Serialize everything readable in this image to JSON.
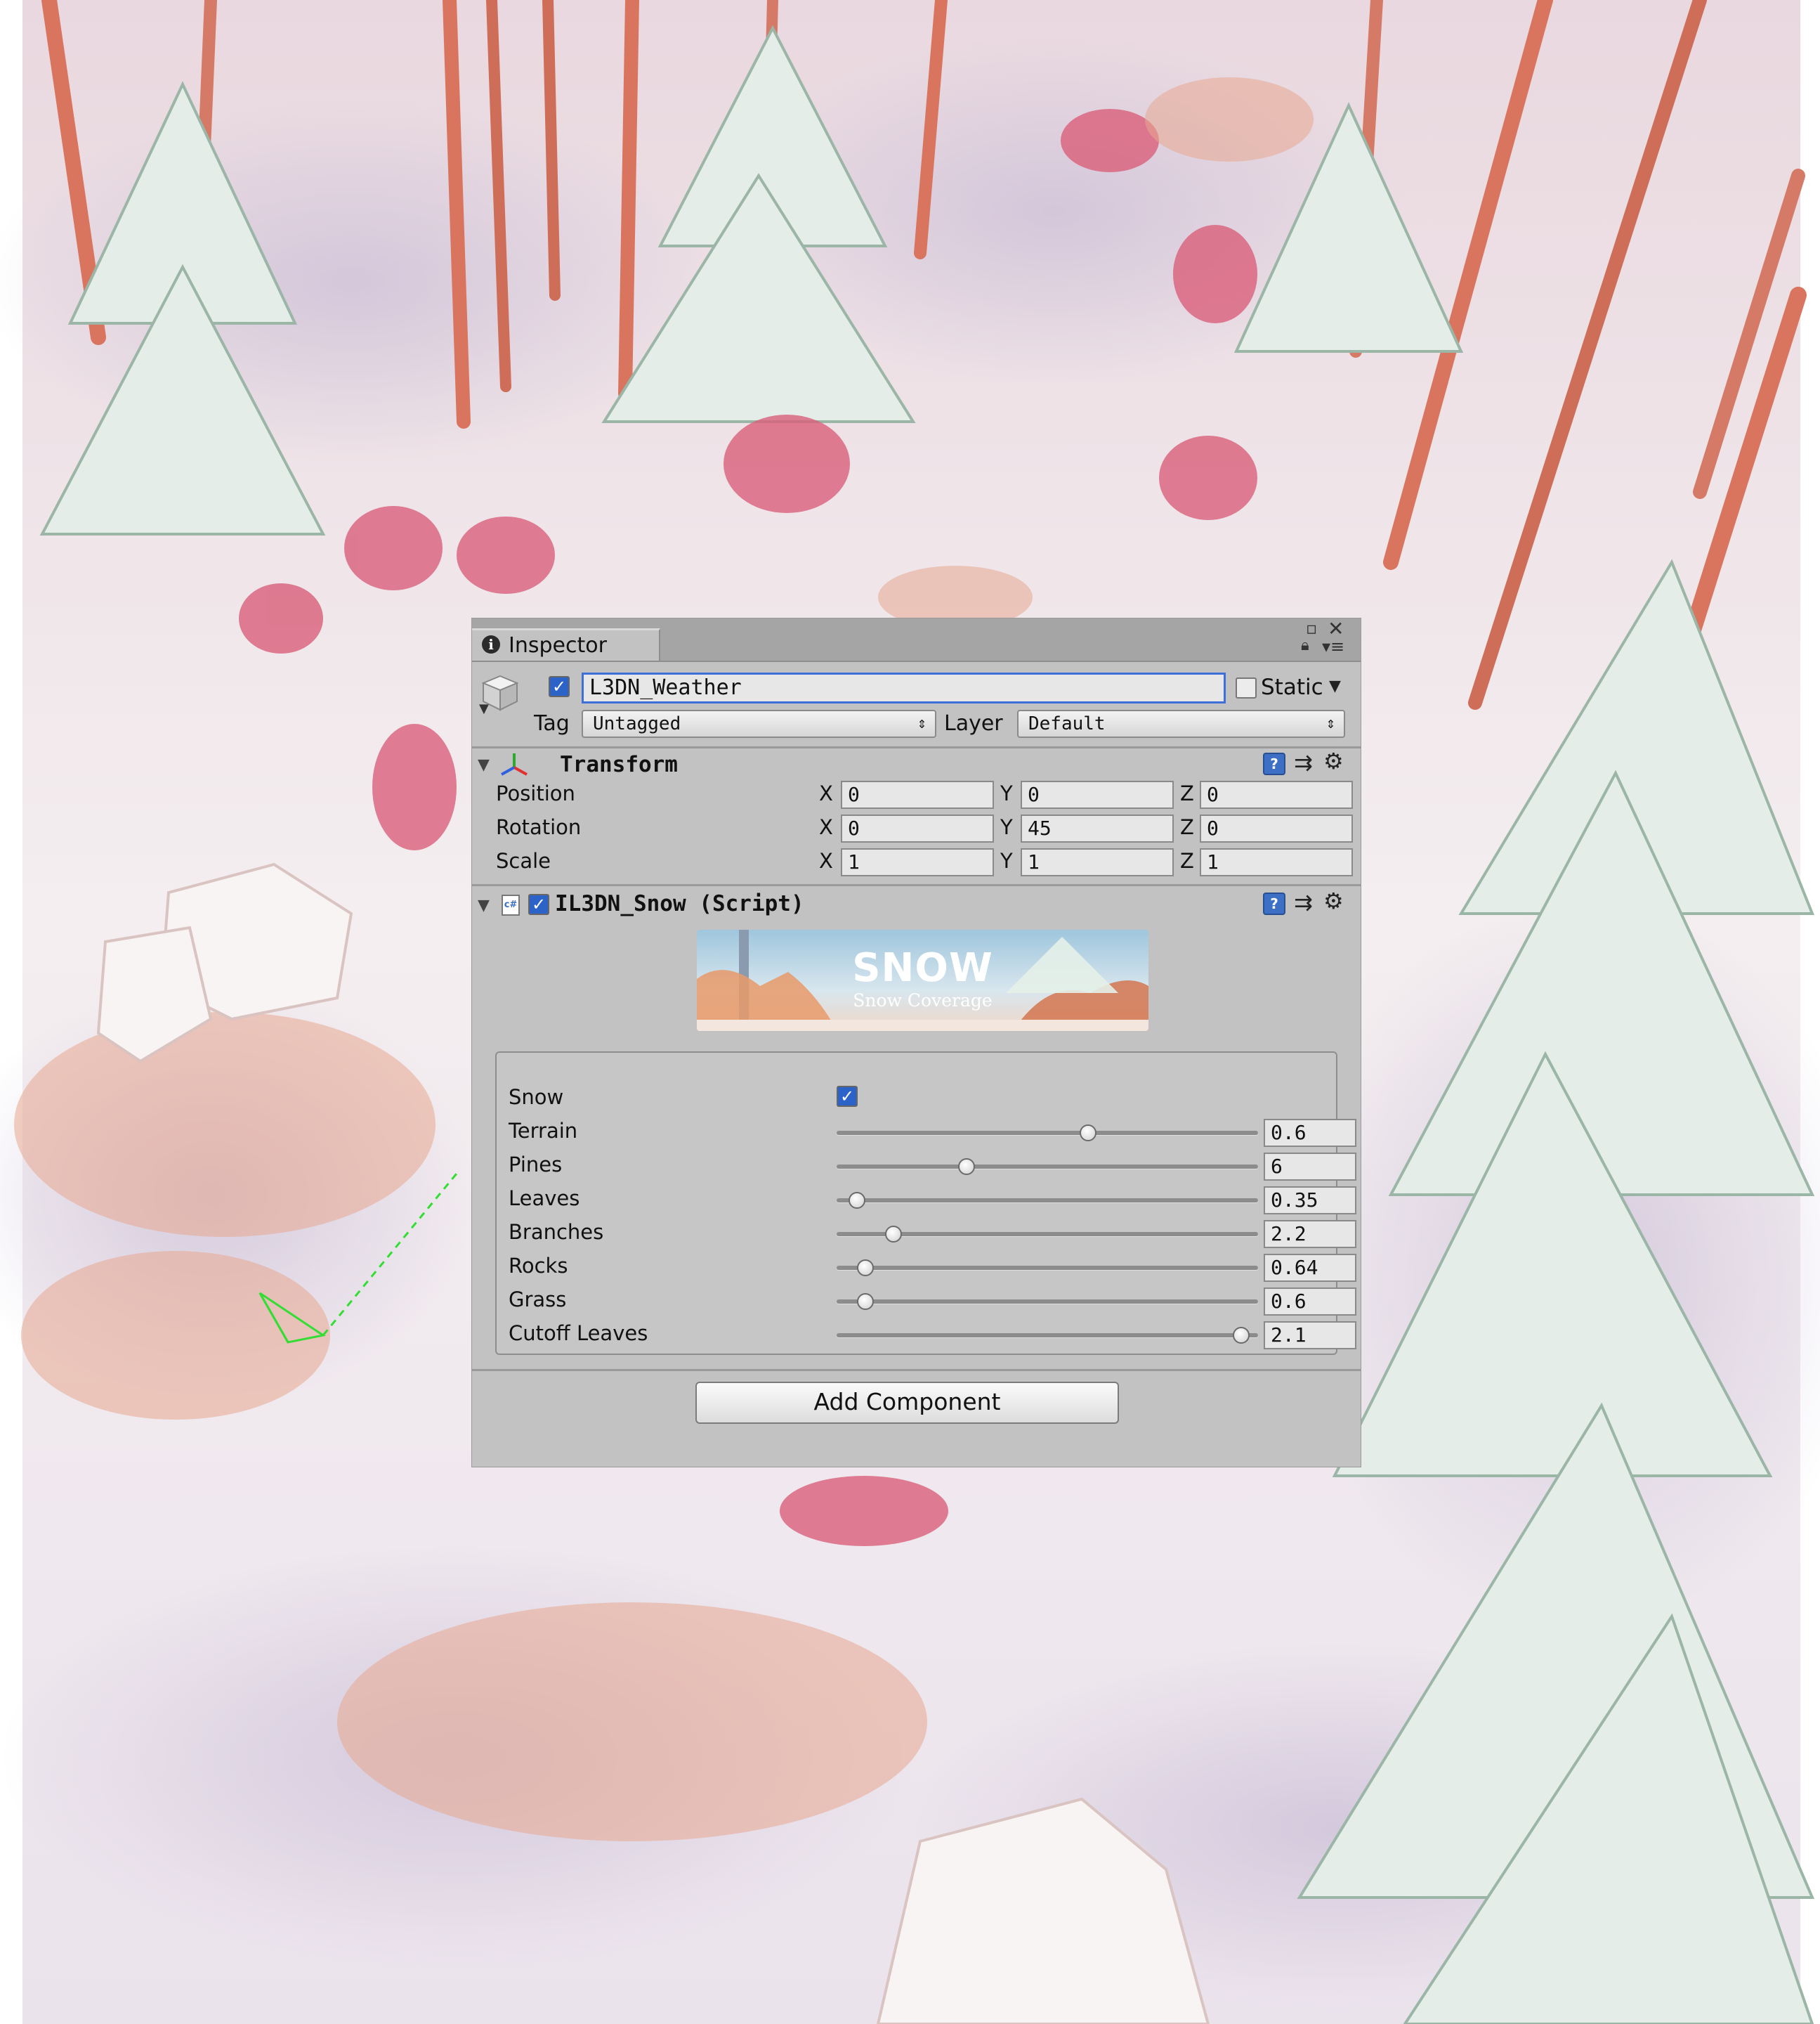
{
  "window": {
    "tab_title": "Inspector"
  },
  "gameobject": {
    "active": true,
    "name": "L3DN_Weather",
    "static_label": "Static",
    "static_checked": false,
    "tag_label": "Tag",
    "tag_value": "Untagged",
    "layer_label": "Layer",
    "layer_value": "Default"
  },
  "transform": {
    "title": "Transform",
    "rows": [
      {
        "label": "Position",
        "x": "0",
        "y": "0",
        "z": "0"
      },
      {
        "label": "Rotation",
        "x": "0",
        "y": "45",
        "z": "0"
      },
      {
        "label": "Scale",
        "x": "1",
        "y": "1",
        "z": "1"
      }
    ],
    "axis_labels": {
      "x": "X",
      "y": "Y",
      "z": "Z"
    }
  },
  "script_component": {
    "enabled": true,
    "title": "IL3DN_Snow (Script)",
    "icon_text": "c#",
    "banner": {
      "title": "SNOW",
      "subtitle": "Snow Coverage"
    },
    "snow_label": "Snow",
    "snow_checked": true,
    "sliders": [
      {
        "label": "Terrain",
        "value": "0.6",
        "fraction": 0.6
      },
      {
        "label": "Pines",
        "value": "6",
        "fraction": 0.3
      },
      {
        "label": "Leaves",
        "value": "0.35",
        "fraction": 0.03
      },
      {
        "label": "Branches",
        "value": "2.2",
        "fraction": 0.12
      },
      {
        "label": "Rocks",
        "value": "0.64",
        "fraction": 0.05
      },
      {
        "label": "Grass",
        "value": "0.6",
        "fraction": 0.05
      },
      {
        "label": "Cutoff Leaves",
        "value": "2.1",
        "fraction": 0.98
      }
    ]
  },
  "add_component_label": "Add Component",
  "colors": {
    "panel_bg": "#c2c2c2",
    "tab_bar": "#a5a5a5",
    "checkbox_blue": "#2b63c8",
    "name_field_border": "#3f6fd8",
    "gizmo_green": "#33dd33"
  }
}
